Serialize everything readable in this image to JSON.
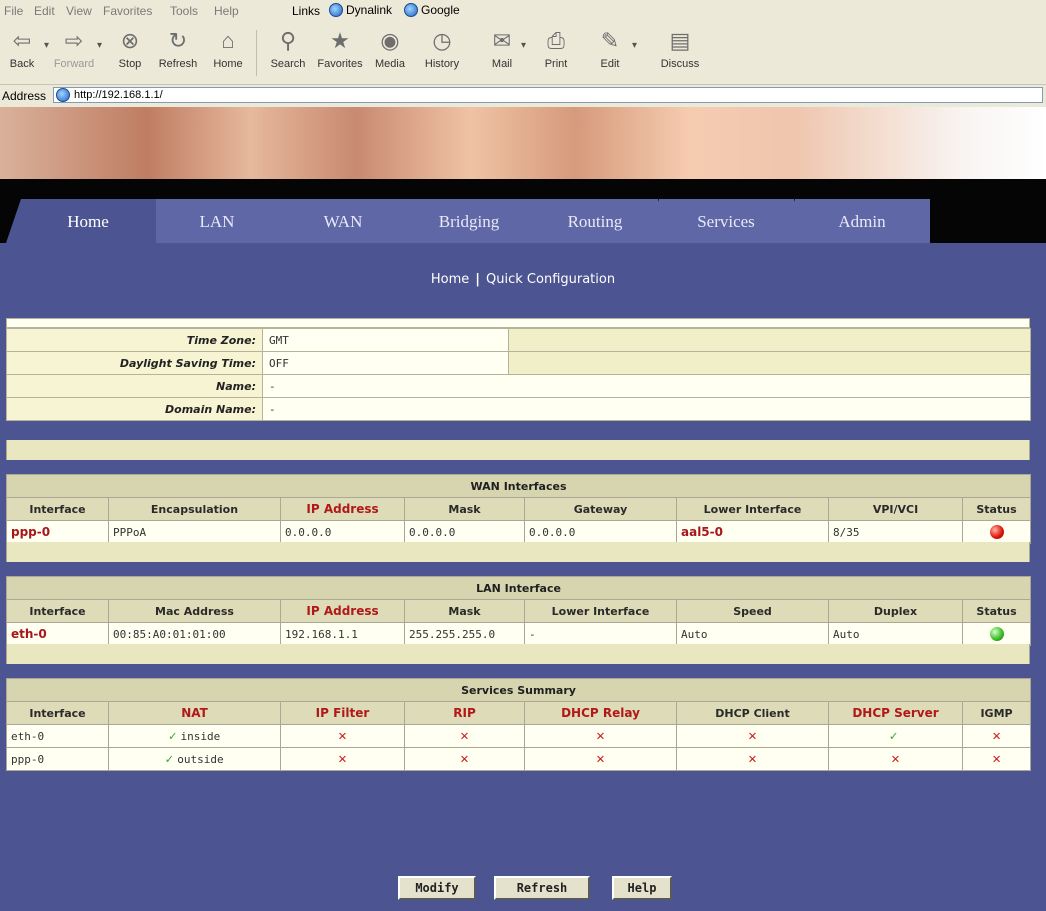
{
  "browser": {
    "menu": [
      "File",
      "Edit",
      "View",
      "Favorites",
      "Tools",
      "Help"
    ],
    "links_label": "Links",
    "links": [
      "Dynalink",
      "Google"
    ],
    "toolbar": {
      "back": "Back",
      "forward": "Forward",
      "stop": "Stop",
      "refresh": "Refresh",
      "home": "Home",
      "search": "Search",
      "favorites": "Favorites",
      "media": "Media",
      "history": "History",
      "mail": "Mail",
      "print": "Print",
      "edit": "Edit",
      "discuss": "Discuss"
    },
    "address_label": "Address",
    "url": "http://192.168.1.1/"
  },
  "nav": {
    "tabs": [
      "Home",
      "LAN",
      "WAN",
      "Bridging",
      "Routing",
      "Services",
      "Admin"
    ],
    "active": "Home"
  },
  "breadcrumb": {
    "home": "Home",
    "page": "Quick Configuration"
  },
  "system_info": [
    {
      "label": "Time Zone:",
      "value": "GMT"
    },
    {
      "label": "Daylight Saving Time:",
      "value": "OFF"
    },
    {
      "label": "Name:",
      "value": "-"
    },
    {
      "label": "Domain Name:",
      "value": "-"
    }
  ],
  "wan": {
    "title": "WAN Interfaces",
    "headers": [
      "Interface",
      "Encapsulation",
      "IP Address",
      "Mask",
      "Gateway",
      "Lower Interface",
      "VPI/VCI",
      "Status"
    ],
    "rows": [
      {
        "interface": "ppp-0",
        "encapsulation": "PPPoA",
        "ip": "0.0.0.0",
        "mask": "0.0.0.0",
        "gateway": "0.0.0.0",
        "lower": "aal5-0",
        "vpivci": "8/35",
        "status": "down"
      }
    ]
  },
  "lan": {
    "title": "LAN Interface",
    "headers": [
      "Interface",
      "Mac Address",
      "IP Address",
      "Mask",
      "Lower Interface",
      "Speed",
      "Duplex",
      "Status"
    ],
    "rows": [
      {
        "interface": "eth-0",
        "mac": "00:85:A0:01:01:00",
        "ip": "192.168.1.1",
        "mask": "255.255.255.0",
        "lower": "-",
        "speed": "Auto",
        "duplex": "Auto",
        "status": "up"
      }
    ]
  },
  "services": {
    "title": "Services Summary",
    "headers": [
      "Interface",
      "NAT",
      "IP Filter",
      "RIP",
      "DHCP Relay",
      "DHCP Client",
      "DHCP Server",
      "IGMP"
    ],
    "rows": [
      {
        "interface": "eth-0",
        "nat": "inside",
        "ip_filter": false,
        "rip": false,
        "dhcp_relay": false,
        "dhcp_client": false,
        "dhcp_server": true,
        "igmp": false
      },
      {
        "interface": "ppp-0",
        "nat": "outside",
        "ip_filter": false,
        "rip": false,
        "dhcp_relay": false,
        "dhcp_client": false,
        "dhcp_server": false,
        "igmp": false
      }
    ]
  },
  "buttons": {
    "modify": "Modify",
    "refresh": "Refresh",
    "help": "Help"
  }
}
